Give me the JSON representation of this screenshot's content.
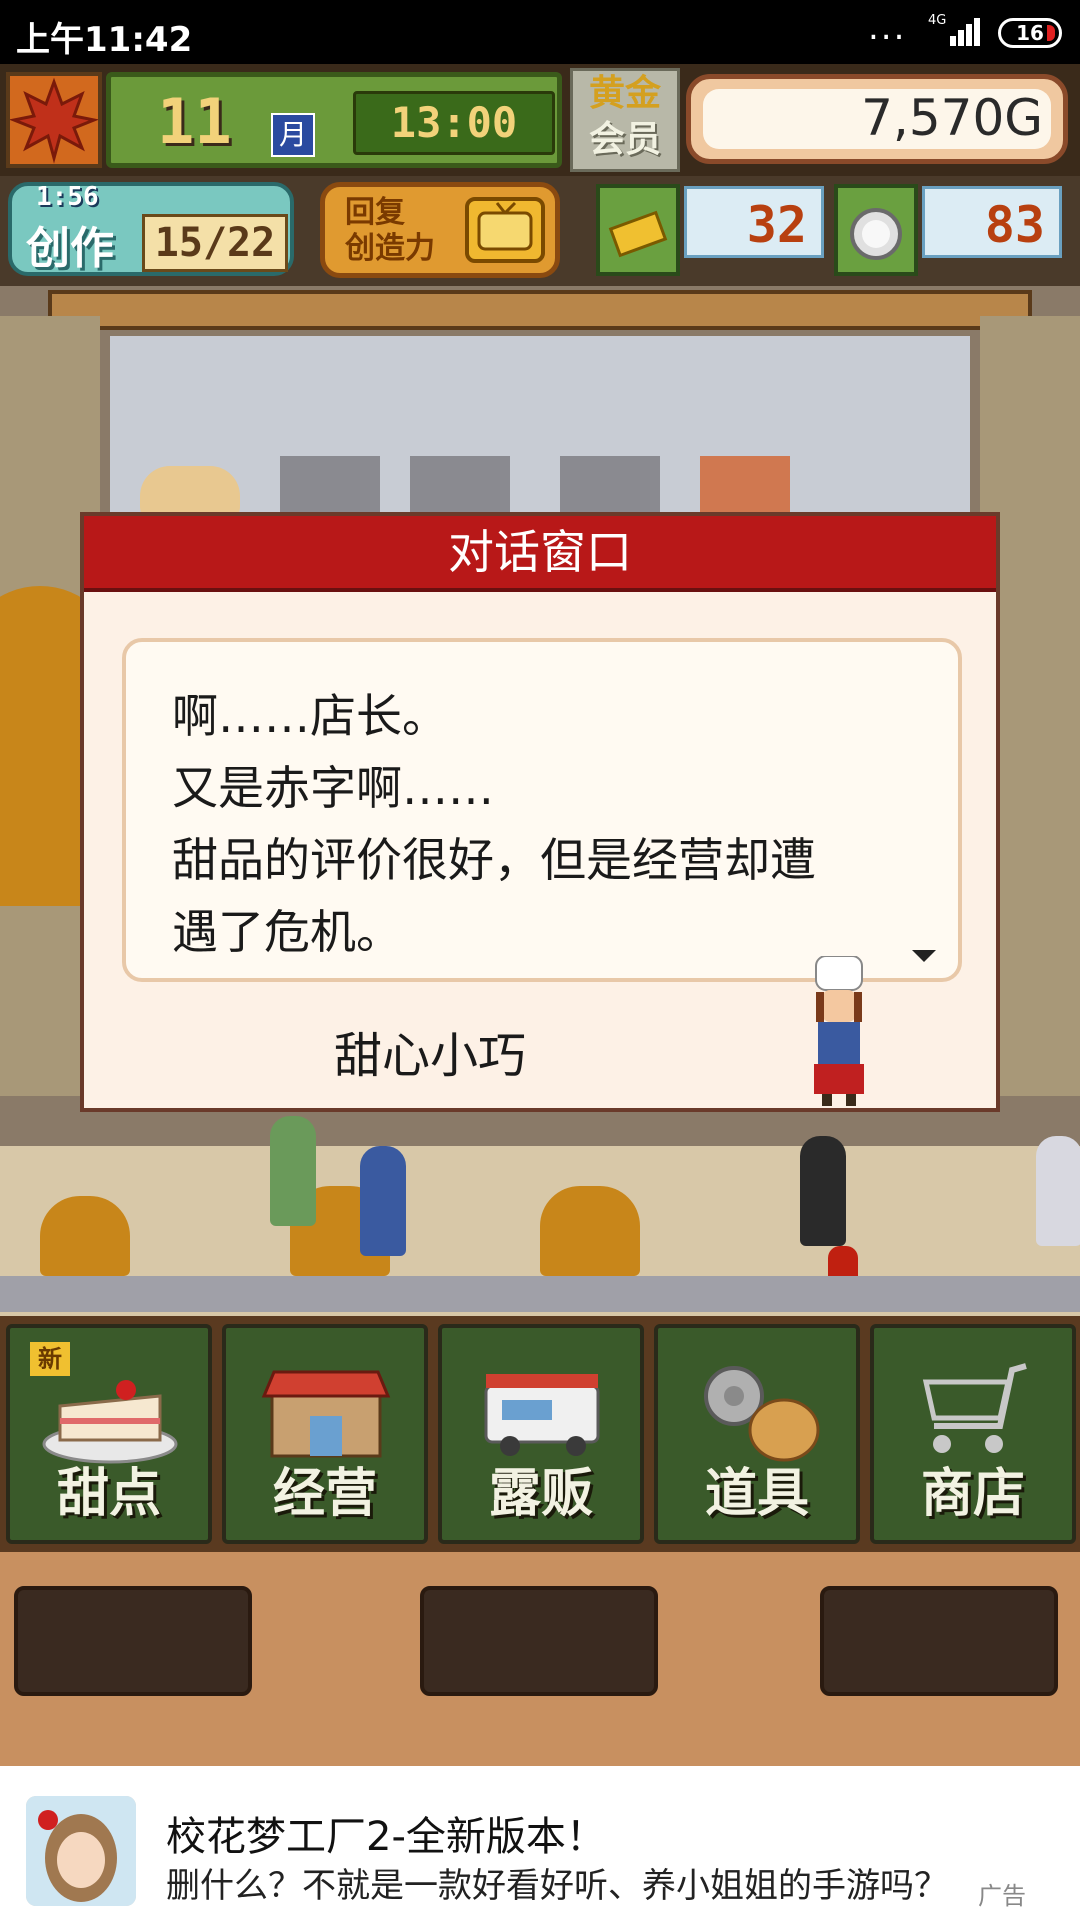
{
  "status_bar": {
    "time": "上午11:42",
    "dots": "...",
    "network": "4G",
    "battery": "16"
  },
  "hud": {
    "month": "11",
    "month_unit": "月",
    "clock": "13:00",
    "gold_member_1": "黄金",
    "gold_member_2": "会员",
    "money": "7,570G"
  },
  "hud2": {
    "create_timer": "1:56",
    "create_label": "创作",
    "create_count": "15/22",
    "restore_label_1": "回复",
    "restore_label_2": "创造力",
    "ticket_count": "32",
    "medal_count": "83"
  },
  "dialog": {
    "title": "对话窗口",
    "lines": [
      "啊……店长。",
      "又是赤字啊……",
      "甜品的评价很好，但是经营却遭",
      "遇了危机。"
    ],
    "speaker": "甜心小巧"
  },
  "menu": {
    "new_badge": "新",
    "items": [
      {
        "label": "甜点",
        "icon": "cake-icon"
      },
      {
        "label": "经营",
        "icon": "shop-icon"
      },
      {
        "label": "露贩",
        "icon": "food-truck-icon"
      },
      {
        "label": "道具",
        "icon": "items-bag-icon"
      },
      {
        "label": "商店",
        "icon": "shopping-cart-icon"
      }
    ]
  },
  "ad": {
    "title": "校花梦工厂2-全新版本！",
    "description": "删什么？不就是一款好看好听、养小姐姐的手游吗？",
    "tag": "广告"
  },
  "colors": {
    "dialog_title_bar": "#b81818",
    "dialog_bg": "#fdf1e6",
    "menu_button_bg": "#3a5a2a",
    "money_text": "#2a2a2a"
  }
}
